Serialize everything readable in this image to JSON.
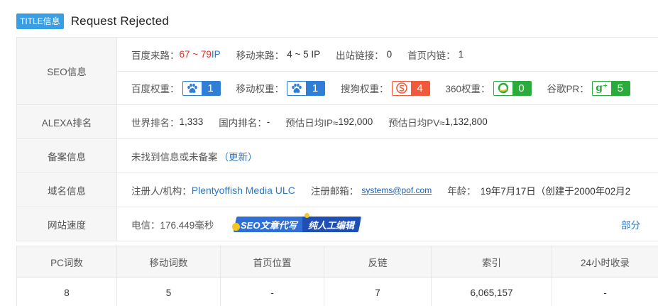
{
  "title": {
    "tag": "TITLE信息",
    "text": "Request Rejected"
  },
  "seo": {
    "label": "SEO信息",
    "baidu_traffic_label": "百度来路：",
    "baidu_traffic_value": "67 ~ 79",
    "baidu_traffic_unit": " IP",
    "mobile_traffic_label": "移动来路：",
    "mobile_traffic_value": "4 ~ 5 IP",
    "outbound_label": "出站链接：",
    "outbound_value": "0",
    "inner_label": "首页内链：",
    "inner_value": "1",
    "baidu_weight_label": "百度权重：",
    "baidu_weight_value": "1",
    "baidu_weight_icon": "paw-icon",
    "baidu_color": "#2f7fd6",
    "mobile_weight_label": "移动权重：",
    "mobile_weight_value": "1",
    "mobile_weight_icon": "paw-icon",
    "sogou_weight_label": "搜狗权重：",
    "sogou_weight_value": "4",
    "sogou_color": "#f05a3a",
    "s360_weight_label": "360权重：",
    "s360_weight_value": "0",
    "s360_color": "#2bab3b",
    "google_pr_label": "谷歌PR：",
    "google_pr_value": "5",
    "google_icon_text": "g⁺"
  },
  "alexa": {
    "label": "ALEXA排名",
    "world_label": "世界排名：",
    "world_value": "1,333",
    "domestic_label": "国内排名：",
    "domestic_value": "-",
    "ip_label": "预估日均IP≈",
    "ip_value": "192,000",
    "pv_label": "预估日均PV≈",
    "pv_value": "1,132,800"
  },
  "beian": {
    "label": "备案信息",
    "text": "未找到信息或未备案",
    "update_link": "（更新）"
  },
  "domain": {
    "label": "域名信息",
    "registrant_label": "注册人/机构：",
    "registrant_value": "Plentyoffish Media ULC",
    "email_label": "注册邮箱：",
    "email_value": "systems@pof.com",
    "age_label": "年龄：",
    "age_value": "19年7月17日（创建于2000年02月2"
  },
  "speed": {
    "label": "网站速度",
    "telecom_label": "电信：",
    "telecom_value": "176.449毫秒",
    "promo_1": "SEO文章代写",
    "promo_2": "纯人工编辑",
    "partial_text": "部分"
  },
  "stats": {
    "headers": [
      "PC词数",
      "移动词数",
      "首页位置",
      "反链",
      "索引",
      "24小时收录"
    ],
    "values": [
      "8",
      "5",
      "-",
      "7",
      "6,065,157",
      "-"
    ]
  }
}
